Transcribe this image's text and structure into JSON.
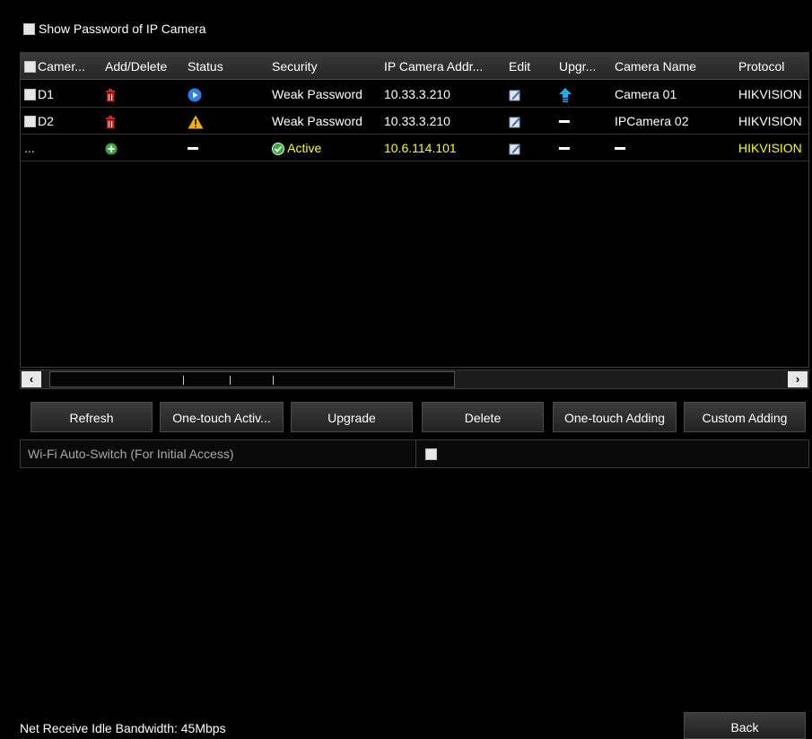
{
  "show_password": {
    "label": "Show Password of IP Camera",
    "checked": false
  },
  "table": {
    "headers": [
      "Camer...",
      "Add/Delete",
      "Status",
      "Security",
      "IP Camera Addr...",
      "Edit",
      "Upgr...",
      "Camera Name",
      "Protocol"
    ],
    "rows": [
      {
        "camera": "D1",
        "action": "delete",
        "status": "playing",
        "security": "Weak Password",
        "ip": "10.33.3.210",
        "upgrade": "upgrade",
        "name": "Camera 01",
        "protocol": "HIKVISION"
      },
      {
        "camera": "D2",
        "action": "delete",
        "status": "warning",
        "security": "Weak Password",
        "ip": "10.33.3.210",
        "upgrade": "none",
        "name": "IPCamera 02",
        "protocol": "HIKVISION"
      },
      {
        "camera": "...",
        "action": "add",
        "status": "none",
        "security": "Active",
        "ip": "10.6.114.101",
        "upgrade": "none",
        "name": "–",
        "protocol": "HIKVISION"
      }
    ]
  },
  "scrollbar": {
    "left": "‹",
    "right": "›"
  },
  "buttons": {
    "refresh": "Refresh",
    "one_touch_activate": "One-touch Activ...",
    "upgrade": "Upgrade",
    "delete": "Delete",
    "one_touch_adding": "One-touch Adding",
    "custom_adding": "Custom Adding"
  },
  "wifi": {
    "label": "Wi-Fi Auto-Switch (For Initial Access)",
    "checked": false
  },
  "footer": {
    "bandwidth": "Net Receive Idle Bandwidth: 45Mbps",
    "back": "Back"
  },
  "colors": {
    "active_row": "#ffff00",
    "delete_icon": "#d32020",
    "add_icon": "#3aa83a",
    "status_play": "#2a7fe0",
    "warning": "#f2b200",
    "upgrade_icon": "#25a6e6"
  },
  "icons": {
    "delete": "trash-icon",
    "add": "plus-circle-icon",
    "play": "play-circle-icon",
    "warning": "warning-icon",
    "edit": "edit-icon",
    "upgrade": "upgrade-arrow-icon",
    "active": "check-circle-icon"
  }
}
